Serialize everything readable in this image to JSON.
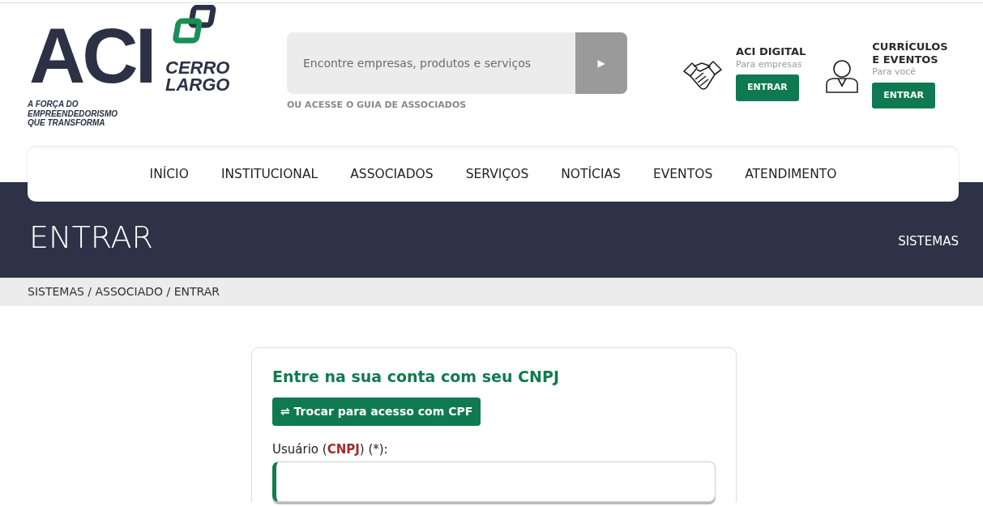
{
  "logo": {
    "mark": "ACI",
    "name_line1": "CERRO",
    "name_line2": "LARGO",
    "tagline": [
      "A FORÇA DO",
      "EMPREENDEDORISMO",
      "QUE TRANSFORMA"
    ]
  },
  "search": {
    "placeholder": "Encontre empresas, produtos e serviços",
    "button": "▶",
    "link": "OU ACESSE O GUIA DE ASSOCIADOS"
  },
  "access": [
    {
      "kind": "handshake",
      "title": [
        "ACI DIGITAL"
      ],
      "subtitle": "Para empresas",
      "button": "ENTRAR"
    },
    {
      "kind": "person",
      "title": [
        "CURRÍCULOS",
        "E EVENTOS"
      ],
      "subtitle": "Para você",
      "button": "ENTRAR"
    }
  ],
  "nav": [
    "INÍCIO",
    "INSTITUCIONAL",
    "ASSOCIADOS",
    "SERVIÇOS",
    "NOTÍCIAS",
    "EVENTOS",
    "ATENDIMENTO"
  ],
  "banner": {
    "title": "ENTRAR",
    "link": "SISTEMAS"
  },
  "breadcrumb": "SISTEMAS / ASSOCIADO / ENTRAR",
  "login": {
    "heading": "Entre na sua conta com seu CNPJ",
    "switch_button": "⇌ Trocar para acesso com CPF",
    "field_label": "Usuário (**CNPJ**) (*):"
  }
}
